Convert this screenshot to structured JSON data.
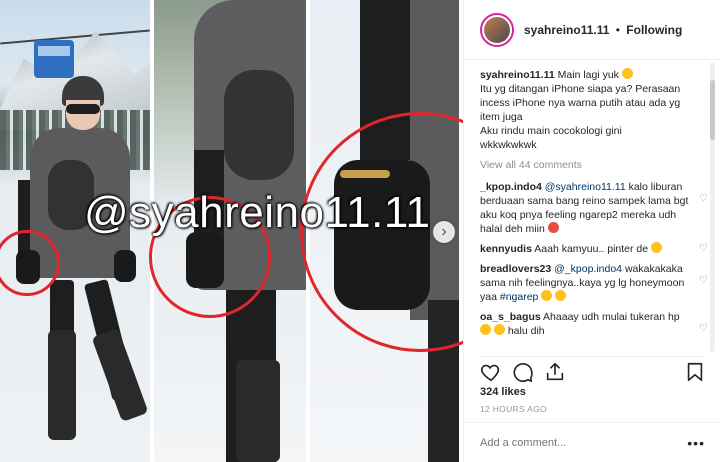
{
  "post": {
    "watermark": "@syahreino11.11",
    "next_glyph": "›"
  },
  "header": {
    "username": "syahreino11.11",
    "separator": "•",
    "follow_status": "Following"
  },
  "caption": {
    "username": "syahreino11.11",
    "line1": "Main lagi yuk",
    "line2": "Itu yg ditangan iPhone siapa ya? Perasaan",
    "line3": "incess iPhone nya warna putih atau ada yg",
    "line4": "item juga",
    "line5": "Aku rindu main cocokologi gini",
    "line6": "wkkwkwkwk"
  },
  "view_all": "View all 44 comments",
  "comments": [
    {
      "username": "_kpop.indo4",
      "mention": "@syahreino11.11",
      "text": "kalo liburan berduaan sama bang reino sampek lama bgt aku koq pnya feeling ngarep2 mereka udh halal deh miin"
    },
    {
      "username": "kennyudis",
      "text": "Aaah kamyuu.. pinter de"
    },
    {
      "username": "breadlovers23",
      "mention": "@_kpop.indo4",
      "text": "wakakakaka sama nih feelingnya..kaya yg lg honeymoon yaa",
      "hashtag": "#ngarep"
    },
    {
      "username": "oa_s_bagus",
      "text": "Ahaaay udh mulai tukeran hp",
      "text2": "halu dih"
    }
  ],
  "icons": {
    "heart": "heart-icon",
    "comment": "comment-icon",
    "share": "share-icon",
    "bookmark": "bookmark-icon",
    "heart_small": "♡"
  },
  "likes": "324 likes",
  "timestamp": "12 HOURS AGO",
  "add_comment": {
    "placeholder": "Add a comment...",
    "more": "•••"
  },
  "colors": {
    "circle": "#e0262b",
    "link": "#003569",
    "muted": "#8e8e8e"
  }
}
